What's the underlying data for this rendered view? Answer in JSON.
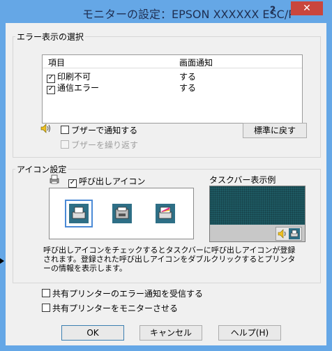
{
  "window": {
    "title": "モニターの設定：EPSON XXXXXX ESC/P",
    "help_glyph": "?",
    "close_glyph": "✕"
  },
  "error_group": {
    "label": "エラー表示の選択",
    "columns": [
      "項目",
      "画面通知"
    ],
    "rows": [
      {
        "item": "印刷不可",
        "notify": "する",
        "checked": true
      },
      {
        "item": "通信エラー",
        "notify": "する",
        "checked": true
      }
    ],
    "buzzer_label": "ブザーで通知する",
    "buzzer_repeat_label": "ブザーを繰り返す",
    "reset_button": "標準に戻す"
  },
  "icon_group": {
    "label": "アイコン設定",
    "callout_label": "呼び出しアイコン",
    "taskbar_label": "タスクバー表示例",
    "description": "呼び出しアイコンをチェックするとタスクバーに呼び出しアイコンが登録されます。登録された呼び出しアイコンをダブルクリックするとプリンターの情報を表示します。"
  },
  "shared": {
    "receive_label": "共有プリンターのエラー通知を受信する",
    "monitor_label": "共有プリンターをモニターさせる"
  },
  "buttons": {
    "ok": "OK",
    "cancel": "キャンセル",
    "help": "ヘルプ(H)"
  },
  "colors": {
    "title_bar": "#65a7e6",
    "close_button": "#c9463d",
    "taskbar_preview": "#1e5a63"
  }
}
